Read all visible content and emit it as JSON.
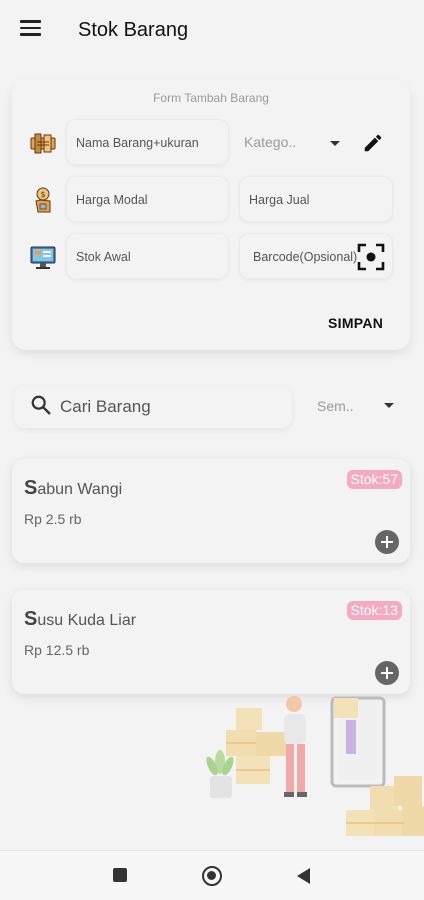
{
  "appbar": {
    "title": "Stok Barang",
    "menu_icon": "hamburger-menu-icon"
  },
  "form": {
    "caption": "Form Tambah Barang",
    "name_placeholder": "Nama Barang+ukuran",
    "category_placeholder": "Katego..",
    "buy_price_placeholder": "Harga Modal",
    "sell_price_placeholder": "Harga Jual",
    "initial_stock_placeholder": "Stok Awal",
    "barcode_placeholder": "Barcode(Opsional)",
    "save_label": "SIMPAN",
    "icons": [
      "product-label-icon",
      "money-hand-icon",
      "computer-monitor-icon",
      "edit-pencil-icon",
      "barcode-scan-icon"
    ]
  },
  "search": {
    "placeholder": "Cari Barang",
    "filter_value": "Sem.."
  },
  "items": [
    {
      "name_first": "S",
      "name_rest": "abun Wangi",
      "price": "Rp 2.5 rb",
      "stock": "Stok:57"
    },
    {
      "name_first": "S",
      "name_rest": "usu Kuda Liar",
      "price": "Rp 12.5 rb",
      "stock": "Stok:13"
    }
  ],
  "colors": {
    "badge": "#f4aac2",
    "background": "#f3f3f3",
    "add_button": "#666666"
  },
  "navbar": {
    "icons": [
      "recents-square-icon",
      "home-circle-icon",
      "back-triangle-icon"
    ]
  }
}
